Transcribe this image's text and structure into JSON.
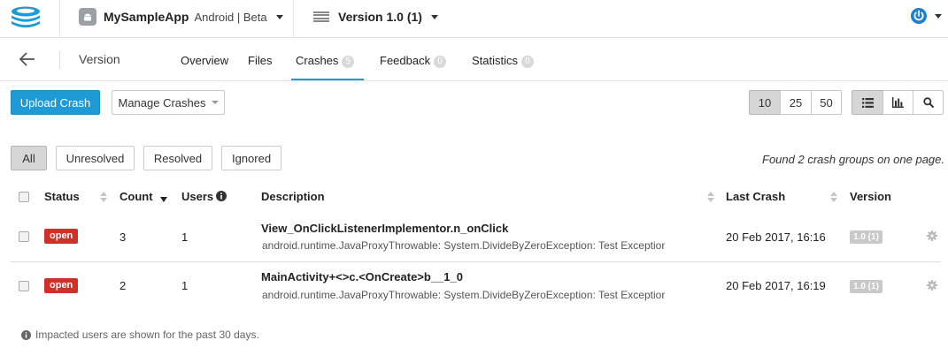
{
  "header": {
    "app_name": "MySampleApp",
    "app_platform": "Android | Beta",
    "version_label": "Version 1.0 (1)"
  },
  "subnav": {
    "back_icon": "arrow-left-icon",
    "title": "Version",
    "tabs": [
      {
        "label": "Overview",
        "badge": null
      },
      {
        "label": "Files",
        "badge": null
      },
      {
        "label": "Crashes",
        "badge": "5",
        "active": true
      },
      {
        "label": "Feedback",
        "badge": "0"
      },
      {
        "label": "Statistics",
        "badge": "0"
      }
    ]
  },
  "toolbar": {
    "upload_label": "Upload Crash",
    "manage_label": "Manage Crashes",
    "page_sizes": [
      "10",
      "25",
      "50"
    ],
    "page_size_selected": "10",
    "view_icons": [
      "list-icon",
      "bar-chart-icon",
      "search-icon"
    ],
    "view_selected": "list-icon"
  },
  "filters": {
    "items": [
      "All",
      "Unresolved",
      "Resolved",
      "Ignored"
    ],
    "selected": "All",
    "found_text": "Found 2 crash groups on one page."
  },
  "table": {
    "headers": {
      "status": "Status",
      "count": "Count",
      "users": "Users",
      "description": "Description",
      "last_crash": "Last Crash",
      "version": "Version"
    },
    "rows": [
      {
        "status": "open",
        "count": "3",
        "users": "1",
        "title": "View_OnClickListenerImplementor.n_onClick",
        "detail": "android.runtime.JavaProxyThrowable: System.DivideByZeroException: Test Exceptior",
        "last_crash": "20 Feb 2017, 16:16",
        "version": "1.0 (1)"
      },
      {
        "status": "open",
        "count": "2",
        "users": "1",
        "title": "MainActivity+<>c.<OnCreate>b__1_0",
        "detail": "android.runtime.JavaProxyThrowable: System.DivideByZeroException: Test Exceptior",
        "last_crash": "20 Feb 2017, 16:19",
        "version": "1.0 (1)"
      }
    ]
  },
  "footnote": "Impacted users are shown for the past 30 days.",
  "colors": {
    "accent": "#1e9bd7",
    "status_open": "#d1302a",
    "logo": "#1e9bd7",
    "power_icon": "#1e7fd0"
  }
}
